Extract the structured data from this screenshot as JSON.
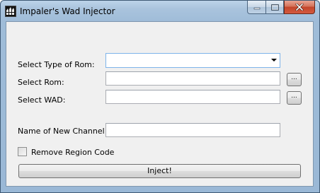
{
  "window": {
    "title": "Impaler's Wad Injector",
    "icon": "app-logo-icon",
    "caption_buttons": [
      "minimize-icon",
      "maximize-icon",
      "close-icon"
    ]
  },
  "form": {
    "rom_type": {
      "label": "Select Type of Rom:",
      "selected": ""
    },
    "rom": {
      "label": "Select Rom:",
      "value": "",
      "browse_label": "..."
    },
    "wad": {
      "label": "Select WAD:",
      "value": "",
      "browse_label": "..."
    },
    "channel_name": {
      "label": "Name of New Channel:",
      "value": ""
    },
    "remove_region": {
      "label": "Remove Region Code",
      "checked": false
    },
    "inject_label": "Inject!"
  },
  "colors": {
    "titlebar": "#a9c3dd",
    "close_button": "#c2452a",
    "client_bg": "#f0f0f0",
    "combo_focus_border": "#7eb4ea"
  }
}
